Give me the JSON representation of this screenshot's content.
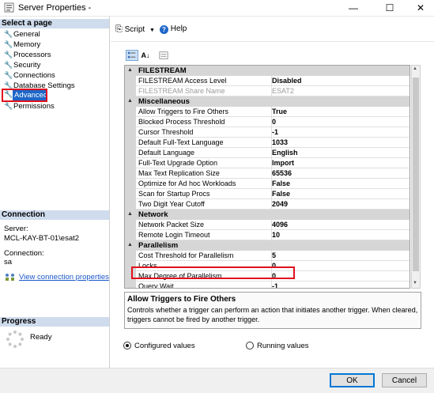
{
  "window": {
    "title": "Server Properties -",
    "minimize": "—",
    "maximize": "☐",
    "close": "✕"
  },
  "left": {
    "select_page_header": "Select a page",
    "nav": [
      {
        "label": "General"
      },
      {
        "label": "Memory"
      },
      {
        "label": "Processors"
      },
      {
        "label": "Security"
      },
      {
        "label": "Connections"
      },
      {
        "label": "Database Settings"
      },
      {
        "label": "Advanced",
        "selected": true
      },
      {
        "label": "Permissions"
      }
    ],
    "connection_header": "Connection",
    "server_label": "Server:",
    "server_value": "MCL-KAY-BT-01\\esat2",
    "connection_label": "Connection:",
    "connection_value": "sa",
    "view_connection": "View connection properties",
    "progress_header": "Progress",
    "progress_status": "Ready"
  },
  "toolbar": {
    "script_label": "Script",
    "help_label": "Help"
  },
  "grid": {
    "categories": [
      {
        "name": "FILESTREAM",
        "rows": [
          {
            "name": "FILESTREAM Access Level",
            "value": "Disabled"
          },
          {
            "name": "FILESTREAM Share Name",
            "value": "ESAT2",
            "dim": true
          }
        ]
      },
      {
        "name": "Miscellaneous",
        "rows": [
          {
            "name": "Allow Triggers to Fire Others",
            "value": "True"
          },
          {
            "name": "Blocked Process Threshold",
            "value": "0"
          },
          {
            "name": "Cursor Threshold",
            "value": "-1"
          },
          {
            "name": "Default Full-Text Language",
            "value": "1033"
          },
          {
            "name": "Default Language",
            "value": "English"
          },
          {
            "name": "Full-Text Upgrade Option",
            "value": "Import"
          },
          {
            "name": "Max Text Replication Size",
            "value": "65536"
          },
          {
            "name": "Optimize for Ad hoc Workloads",
            "value": "False"
          },
          {
            "name": "Scan for Startup Procs",
            "value": "False"
          },
          {
            "name": "Two Digit Year Cutoff",
            "value": "2049"
          }
        ]
      },
      {
        "name": "Network",
        "rows": [
          {
            "name": "Network Packet Size",
            "value": "4096"
          },
          {
            "name": "Remote Login Timeout",
            "value": "10"
          }
        ]
      },
      {
        "name": "Parallelism",
        "rows": [
          {
            "name": "Cost Threshold for Parallelism",
            "value": "5"
          },
          {
            "name": "Locks",
            "value": "0"
          },
          {
            "name": "Max Degree of Parallelism",
            "value": "0"
          },
          {
            "name": "Query Wait",
            "value": "-1"
          }
        ]
      }
    ]
  },
  "description": {
    "title": "Allow Triggers to Fire Others",
    "text": "Controls whether a trigger can perform an action that initiates another trigger. When cleared, triggers cannot be fired by another trigger."
  },
  "options": {
    "configured": "Configured values",
    "running": "Running values",
    "selected": "configured"
  },
  "buttons": {
    "ok": "OK",
    "cancel": "Cancel"
  },
  "colors": {
    "highlight_box": "#e0101e",
    "selection": "#1e66c8",
    "section_header": "#cfdced"
  }
}
